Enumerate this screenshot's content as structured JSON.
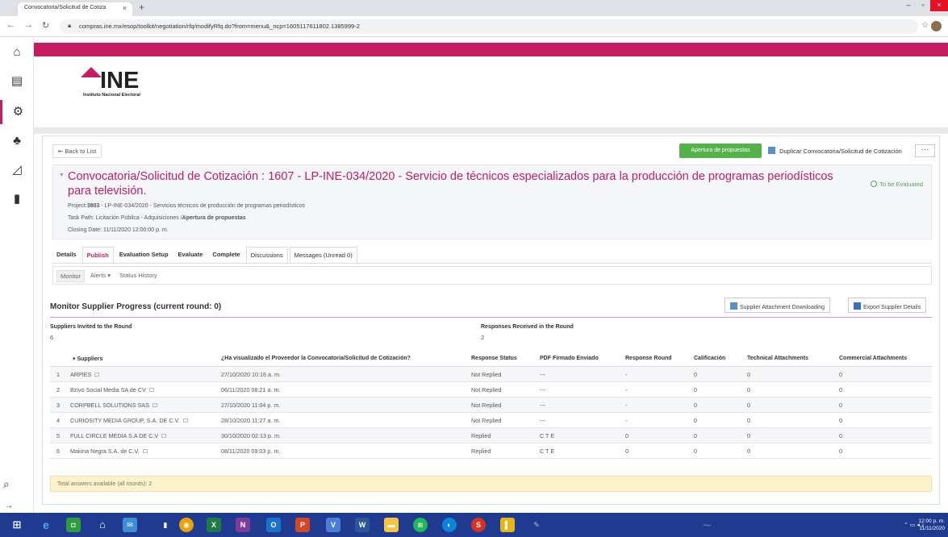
{
  "browser": {
    "tab_title": "Convocatoria/Solicitud de Cotiza",
    "close_glyph": "×",
    "new_tab_glyph": "+",
    "url": "compras.ine.mx/esop/toolkit/negotiation/rfq/modifyRfq.do?from=menu&_ncp=1605117611802.1385999-2"
  },
  "logo": {
    "word": "INE",
    "subtitle": "Instituto Nacional Electoral"
  },
  "toolbar": {
    "back_label": "Back to List",
    "apertura_label": "Apertura de propuestas",
    "duplicate_label": "Duplicar Convocatoria/Solicitud de Cotización",
    "more_label": "···"
  },
  "header": {
    "title": "Convocatoria/Solicitud de Cotización : 1607 - LP-INE-034/2020 - Servicio de técnicos especializados para la producción de programas periodísticos para televisión.",
    "status": "To be Evaluated",
    "project_label": "Project:",
    "project_code": "3803",
    "project_desc": "- LP-INE-034/2020 - Servicios técnicos de producción de programas periodísticos",
    "task_path_label": "Task Path: Licitación Pública - Adquisiciones /",
    "task_path_current": "Apertura de propuestas",
    "closing_date": "Closing Date: 11/11/2020 12:00:00 p. m."
  },
  "tabs": [
    {
      "label": "Details"
    },
    {
      "label": "Publish"
    },
    {
      "label": "Evaluation Setup"
    },
    {
      "label": "Evaluate"
    },
    {
      "label": "Complete"
    },
    {
      "label": "Discussions"
    },
    {
      "label": "Messages (Unread 0)"
    }
  ],
  "subnav": {
    "monitor": "Monitor",
    "alerts": "Alerts",
    "alerts_caret": "▾",
    "status_history": "Status History"
  },
  "section": {
    "title": "Monitor Supplier Progress (current round: 0)",
    "attach_download": "Supplier Attachment Downloading",
    "export": "Export Supplier Details"
  },
  "stats": {
    "invited_label": "Suppliers Invited to the Round",
    "invited_value": "6",
    "received_label": "Responses Received in the Round",
    "received_value": "2"
  },
  "table": {
    "columns": [
      "Suppliers",
      "¿Ha visualizado el Proveedor la Convocatoria/Solicitud de Cotización?",
      "Response Status",
      "PDF Firmado Enviado",
      "Response Round",
      "Calificación",
      "Technical Attachments",
      "Commercial Attachments"
    ],
    "rows": [
      {
        "n": "1",
        "name": "ARPIES",
        "viewed": "27/10/2020 10:16 a. m.",
        "status": "Not Replied",
        "pdf": "---",
        "round": "-",
        "cal": "0",
        "tech": "0",
        "com": "0"
      },
      {
        "n": "2",
        "name": "Bzivo Social Media SA de CV",
        "viewed": "06/11/2020 08:21 a. m.",
        "status": "Not Replied",
        "pdf": "---",
        "round": "-",
        "cal": "0",
        "tech": "0",
        "com": "0"
      },
      {
        "n": "3",
        "name": "CORPBELL SOLUTIONS SAS",
        "viewed": "27/10/2020 11:04 p. m.",
        "status": "Not Replied",
        "pdf": "---",
        "round": "-",
        "cal": "0",
        "tech": "0",
        "com": "0"
      },
      {
        "n": "4",
        "name": "CURIOSITY MEDIA GROUP, S.A. DE C.V.",
        "viewed": "28/10/2020 11:27 a. m.",
        "status": "Not Replied",
        "pdf": "---",
        "round": "-",
        "cal": "0",
        "tech": "0",
        "com": "0"
      },
      {
        "n": "5",
        "name": "FULL CIRCLE MEDIA S.A DE C.V",
        "viewed": "30/10/2020 02:13 p. m.",
        "status": "Replied",
        "pdf": "C T E",
        "round": "0",
        "cal": "0",
        "tech": "0",
        "com": "0"
      },
      {
        "n": "6",
        "name": "Makina Negra S.A. de C.V.",
        "viewed": "08/11/2020 09:03 p. m.",
        "status": "Replied",
        "pdf": "C T E",
        "round": "0",
        "cal": "0",
        "tech": "0",
        "com": "0"
      }
    ],
    "footer": "Total answers available (all rounds): 2"
  },
  "taskbar": {
    "time": "12:00 p. m.",
    "date": "11/11/2020"
  },
  "colors": {
    "brand": "#c51d63",
    "green": "#54b24a",
    "taskbar": "#1f3a8e"
  }
}
